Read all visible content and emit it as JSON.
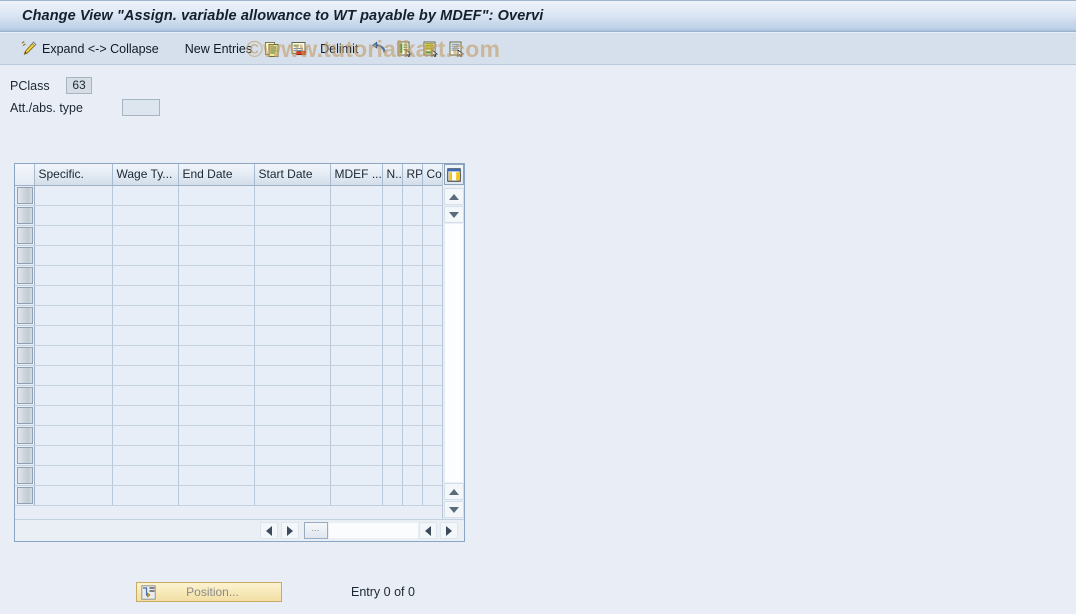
{
  "window": {
    "title": "Change View \"Assign. variable allowance to WT payable by MDEF\": Overvi"
  },
  "watermark": {
    "text": "©www.tutorialkart.com"
  },
  "toolbar": {
    "items": [
      {
        "icon": "pencil-icon",
        "label": "Expand <-> Collapse"
      },
      {
        "icon": "new-entries-icon",
        "label": "New Entries"
      },
      {
        "icon": "copy-icon",
        "label": ""
      },
      {
        "icon": "delete-row-icon",
        "label": ""
      },
      {
        "icon": "delimit-icon",
        "label": "Delimit"
      },
      {
        "icon": "undo-icon",
        "label": ""
      },
      {
        "icon": "select-all-icon",
        "label": ""
      },
      {
        "icon": "select-block-icon",
        "label": ""
      },
      {
        "icon": "deselect-icon",
        "label": ""
      }
    ]
  },
  "fields": {
    "pclass": {
      "label": "PClass",
      "value": "63"
    },
    "att_abs_type": {
      "label": "Att./abs. type",
      "value": "",
      "placeholder": ""
    }
  },
  "table": {
    "columns": [
      {
        "key": "select",
        "label": ""
      },
      {
        "key": "specific",
        "label": "Specific."
      },
      {
        "key": "wage_type",
        "label": "Wage Ty..."
      },
      {
        "key": "end_date",
        "label": "End Date"
      },
      {
        "key": "start_date",
        "label": "Start Date"
      },
      {
        "key": "mdef",
        "label": "MDEF ..."
      },
      {
        "key": "n",
        "label": "N.."
      },
      {
        "key": "rp",
        "label": "RP"
      },
      {
        "key": "co",
        "label": "Co"
      }
    ],
    "config_icon": "table-settings-icon",
    "rows": [],
    "empty_row_count": 16,
    "vertical_scroll": {
      "up_icon": "scroll-up-icon",
      "down_icon": "scroll-down-icon"
    },
    "horizontal_scroll": {
      "left_icon": "scroll-left-icon",
      "right_icon": "scroll-right-icon",
      "thumb_icon": "scroll-thumb-grip"
    }
  },
  "footer": {
    "position_button": {
      "label": "Position...",
      "icon": "position-icon"
    },
    "entry_count": "Entry 0 of 0"
  },
  "colors": {
    "titlebar_start": "#eef3fa",
    "titlebar_end": "#a9c1dc",
    "toolbar_bg": "#d5e0ec",
    "page_bg": "#e9eef6",
    "cell_bg": "#e8eef7",
    "accent_yellow": "#f2dfa4",
    "watermark": "#c49e68"
  }
}
